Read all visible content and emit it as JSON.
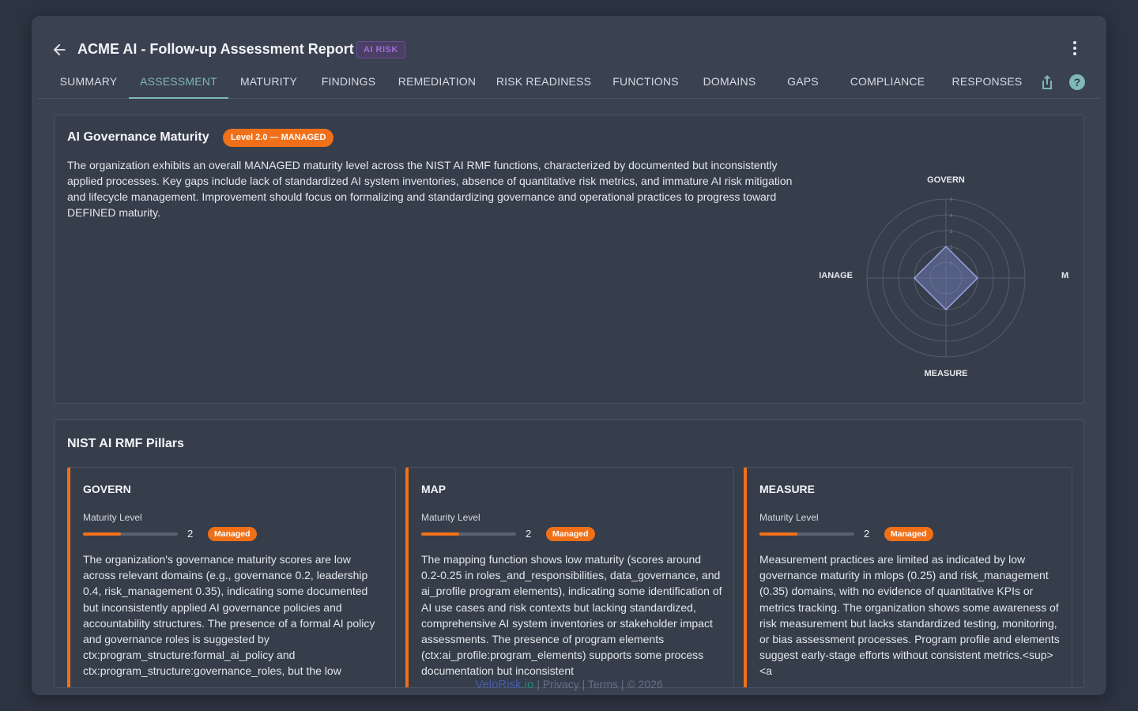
{
  "header": {
    "title": "ACME AI - Follow-up Assessment Report",
    "badge": "AI RISK",
    "icons": {
      "back": "arrow-left-icon",
      "menu": "more-vert-icon",
      "share": "share-icon",
      "help": "help-circle-icon"
    }
  },
  "tabs": [
    "SUMMARY",
    "ASSESSMENT",
    "MATURITY",
    "FINDINGS",
    "REMEDIATION",
    "RISK READINESS",
    "FUNCTIONS",
    "DOMAINS",
    "GAPS",
    "COMPLIANCE",
    "RESPONSES"
  ],
  "active_tab": "ASSESSMENT",
  "maturity": {
    "title": "AI Governance Maturity",
    "level_badge": "Level 2.0 — MANAGED",
    "summary": "The organization exhibits an overall MANAGED maturity level across the NIST AI RMF functions, characterized by documented but inconsistently applied processes. Key gaps include lack of standardized AI system inventories, absence of quantitative risk metrics, and immature AI risk mitigation and lifecycle management. Improvement should focus on formalizing and standardizing governance and operational practices to progress toward DEFINED maturity.",
    "radar": {
      "axes": [
        "GOVERN",
        "MAP",
        "MEASURE",
        "MANAGE"
      ],
      "values": [
        2,
        2,
        2,
        2
      ],
      "max": 5,
      "ticks": [
        "1",
        "2",
        "3",
        "4",
        "5"
      ]
    }
  },
  "pillars": {
    "title": "NIST AI RMF Pillars",
    "items": [
      {
        "name": "GOVERN",
        "label": "Maturity Level",
        "value": "2",
        "level": 2,
        "max": 5,
        "badge": "Managed",
        "text": "The organization's governance maturity scores are low across relevant domains (e.g., governance 0.2, leadership 0.4, risk_management 0.35), indicating some documented but inconsistently applied AI governance policies and accountability structures. The presence of a formal AI policy and governance roles is suggested by ctx:program_structure:formal_ai_policy and ctx:program_structure:governance_roles, but the low"
      },
      {
        "name": "MAP",
        "label": "Maturity Level",
        "value": "2",
        "level": 2,
        "max": 5,
        "badge": "Managed",
        "text": "The mapping function shows low maturity (scores around 0.2-0.25 in roles_and_responsibilities, data_governance, and ai_profile program elements), indicating some identification of AI use cases and risk contexts but lacking standardized, comprehensive AI system inventories or stakeholder impact assessments. The presence of program elements (ctx:ai_profile:program_elements) supports some process documentation but inconsistent"
      },
      {
        "name": "MEASURE",
        "label": "Maturity Level",
        "value": "2",
        "level": 2,
        "max": 5,
        "badge": "Managed",
        "text": "Measurement practices are limited as indicated by low governance maturity in mlops (0.25) and risk_management (0.35) domains, with no evidence of quantitative KPIs or metrics tracking. The organization shows some awareness of risk measurement but lacks standardized testing, monitoring, or bias assessment processes. Program profile and elements suggest early-stage efforts without consistent metrics.<sup><a"
      }
    ]
  },
  "footer": {
    "brand": "VeloRisk",
    "brand_tld": ".io",
    "links": "| Privacy | Terms | © 2026"
  },
  "colors": {
    "accent_orange": "#f07019",
    "accent_teal": "#7fb8b6",
    "radar_fill": "#7b84c6",
    "badge_purple": "#a06cd5"
  }
}
